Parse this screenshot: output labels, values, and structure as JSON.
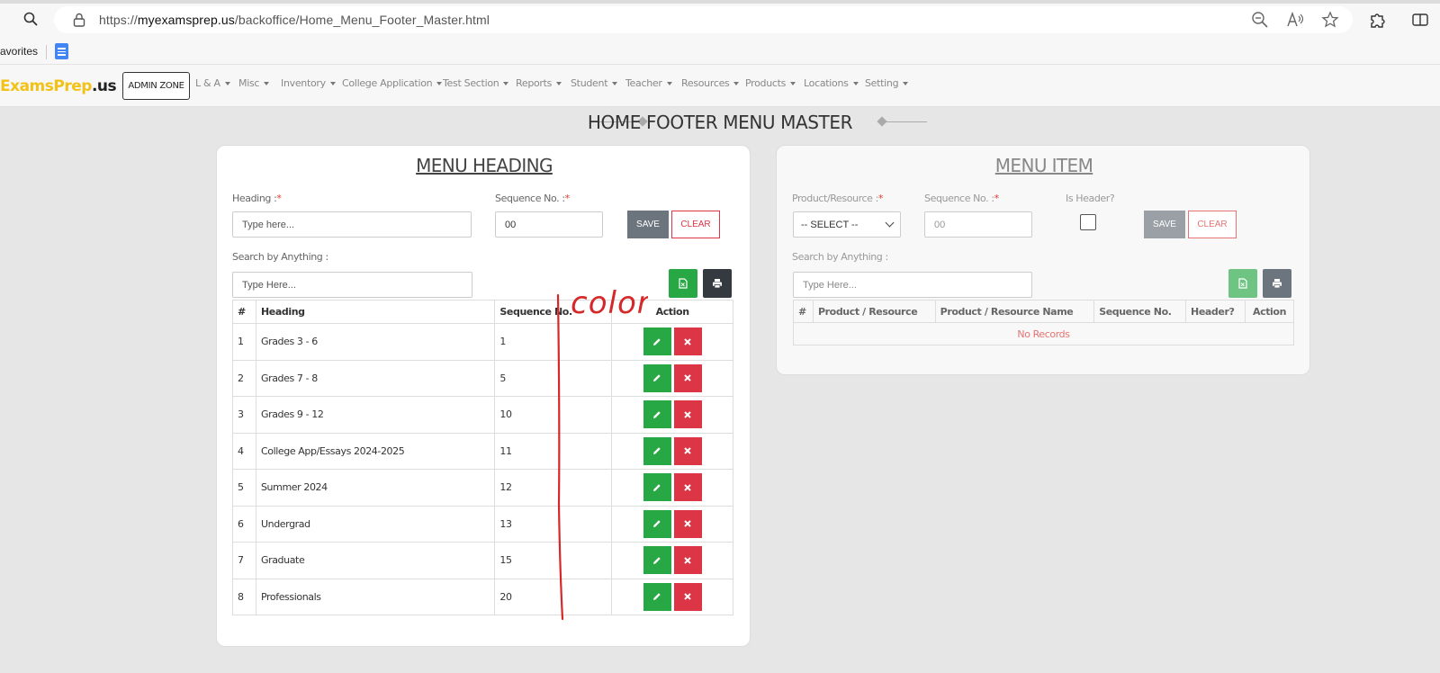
{
  "browser": {
    "url_scheme": "https://",
    "url_host": "myexamsprep.us",
    "url_path": "/backoffice/Home_Menu_Footer_Master.html",
    "favorites_label": "avorites"
  },
  "appnav": {
    "logo_left": "ExamsPrep",
    "logo_right": ".us",
    "admin_zone": "ADMIN ZONE",
    "menus": [
      "L & A",
      "Misc",
      "Inventory",
      "College Application",
      "Test Section",
      "Reports",
      "Student",
      "Teacher",
      "Resources",
      "Products",
      "Locations",
      "Setting"
    ]
  },
  "page": {
    "title": "HOME FOOTER MENU MASTER"
  },
  "menu_heading": {
    "title": "MENU HEADING",
    "heading_label": "Heading :",
    "heading_placeholder": "Type here...",
    "sequence_label": "Sequence No. :",
    "sequence_value": "00",
    "save_label": "SAVE",
    "clear_label": "CLEAR",
    "search_label": "Search by Anything :",
    "search_placeholder": "Type Here...",
    "columns": [
      "#",
      "Heading",
      "Sequence No.",
      "Action"
    ],
    "rows": [
      {
        "num": "1",
        "heading": "Grades 3 - 6",
        "seq": "1"
      },
      {
        "num": "2",
        "heading": "Grades 7 - 8",
        "seq": "5"
      },
      {
        "num": "3",
        "heading": "Grades 9 - 12",
        "seq": "10"
      },
      {
        "num": "4",
        "heading": "College App/Essays 2024-2025",
        "seq": "11"
      },
      {
        "num": "5",
        "heading": "Summer 2024",
        "seq": "12"
      },
      {
        "num": "6",
        "heading": "Undergrad",
        "seq": "13"
      },
      {
        "num": "7",
        "heading": "Graduate",
        "seq": "15"
      },
      {
        "num": "8",
        "heading": "Professionals",
        "seq": "20"
      }
    ]
  },
  "menu_item": {
    "title": "MENU ITEM",
    "product_label": "Product/Resource :",
    "product_selected": "-- SELECT --",
    "sequence_label": "Sequence No. :",
    "sequence_value": "00",
    "is_header_label": "Is Header?",
    "save_label": "SAVE",
    "clear_label": "CLEAR",
    "search_label": "Search by Anything :",
    "search_placeholder": "Type Here...",
    "columns": [
      "#",
      "Product / Resource",
      "Product / Resource Name",
      "Sequence No.",
      "Header?",
      "Action"
    ],
    "empty_text": "No Records"
  },
  "annotation": {
    "text": "color",
    "color": "#d62828"
  },
  "colors": {
    "green": "#28a745",
    "red": "#dc3545",
    "gray": "#6c757d",
    "dark": "#343a40",
    "logo_yellow": "#f2c218"
  }
}
